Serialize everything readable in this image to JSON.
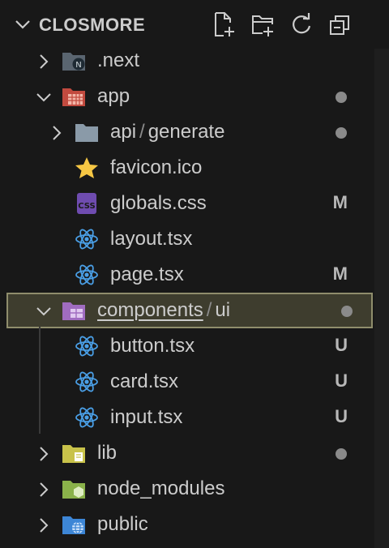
{
  "section": {
    "title": "CLOSMORE",
    "actions": [
      "new-file-icon",
      "new-folder-icon",
      "refresh-icon",
      "collapse-all-icon"
    ]
  },
  "tree": [
    {
      "label": ".next",
      "indent": 0,
      "twisty": "right",
      "icon": "next-folder-icon",
      "status": ""
    },
    {
      "label": "app",
      "indent": 0,
      "twisty": "down",
      "icon": "app-folder-icon",
      "status": "dot"
    },
    {
      "label": "api",
      "label2": "generate",
      "indent": 1,
      "twisty": "right",
      "icon": "folder-icon",
      "status": "dot"
    },
    {
      "label": "favicon.ico",
      "indent": 1,
      "icon": "star-icon",
      "status": ""
    },
    {
      "label": "globals.css",
      "indent": 1,
      "icon": "css-icon",
      "status": "M"
    },
    {
      "label": "layout.tsx",
      "indent": 1,
      "icon": "react-icon",
      "status": ""
    },
    {
      "label": "page.tsx",
      "indent": 1,
      "icon": "react-icon",
      "status": "M"
    },
    {
      "label": "components",
      "label2": "ui",
      "indent": 0,
      "twisty": "down",
      "icon": "components-folder-icon",
      "status": "dot",
      "selected": true
    },
    {
      "label": "button.tsx",
      "indent": 1,
      "icon": "react-icon",
      "status": "U"
    },
    {
      "label": "card.tsx",
      "indent": 1,
      "icon": "react-icon",
      "status": "U"
    },
    {
      "label": "input.tsx",
      "indent": 1,
      "icon": "react-icon",
      "status": "U"
    },
    {
      "label": "lib",
      "indent": 0,
      "twisty": "right",
      "icon": "lib-folder-icon",
      "status": "dot"
    },
    {
      "label": "node_modules",
      "indent": 0,
      "twisty": "right",
      "icon": "node-modules-folder-icon",
      "status": ""
    },
    {
      "label": "public",
      "indent": 0,
      "twisty": "right",
      "icon": "public-folder-icon",
      "status": ""
    }
  ],
  "colors": {
    "background": "#181818",
    "selected_bg": "#3e3d2e",
    "selected_border": "#8f8d6c",
    "react": "#4a9fe6",
    "css": "#6f4cb0"
  }
}
